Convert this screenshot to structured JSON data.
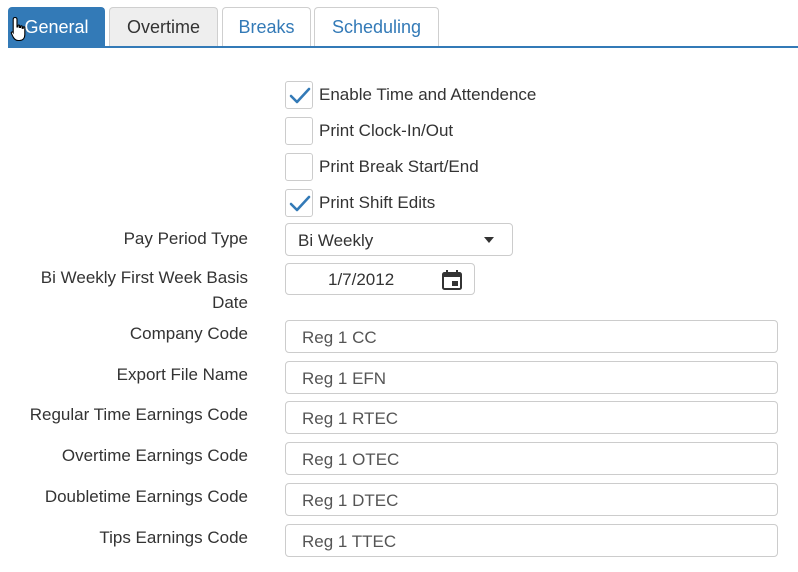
{
  "tabs": [
    {
      "label": "General"
    },
    {
      "label": "Overtime"
    },
    {
      "label": "Breaks"
    },
    {
      "label": "Scheduling"
    }
  ],
  "checkboxes": [
    {
      "label": "Enable Time and Attendence",
      "checked": true
    },
    {
      "label": "Print Clock-In/Out",
      "checked": false
    },
    {
      "label": "Print Break Start/End",
      "checked": false
    },
    {
      "label": "Print Shift Edits",
      "checked": true
    }
  ],
  "pay_period": {
    "label": "Pay Period Type",
    "value": "Bi Weekly"
  },
  "first_week": {
    "label_line1": "Bi Weekly First Week Basis",
    "label_line2": "Date",
    "value": "1/7/2012"
  },
  "fields": {
    "company_code": {
      "label": "Company Code",
      "value": "Reg 1 CC"
    },
    "export_file_name": {
      "label": "Export File Name",
      "value": "Reg 1 EFN"
    },
    "regular_time": {
      "label": "Regular Time Earnings Code",
      "value": "Reg 1 RTEC"
    },
    "overtime": {
      "label": "Overtime Earnings Code",
      "value": "Reg 1 OTEC"
    },
    "doubletime": {
      "label": "Doubletime Earnings Code",
      "value": "Reg 1 DTEC"
    },
    "tips": {
      "label": "Tips Earnings Code",
      "value": "Reg 1 TTEC"
    }
  },
  "colors": {
    "accent": "#337ab7",
    "text": "#333333",
    "border": "#cccccc"
  }
}
